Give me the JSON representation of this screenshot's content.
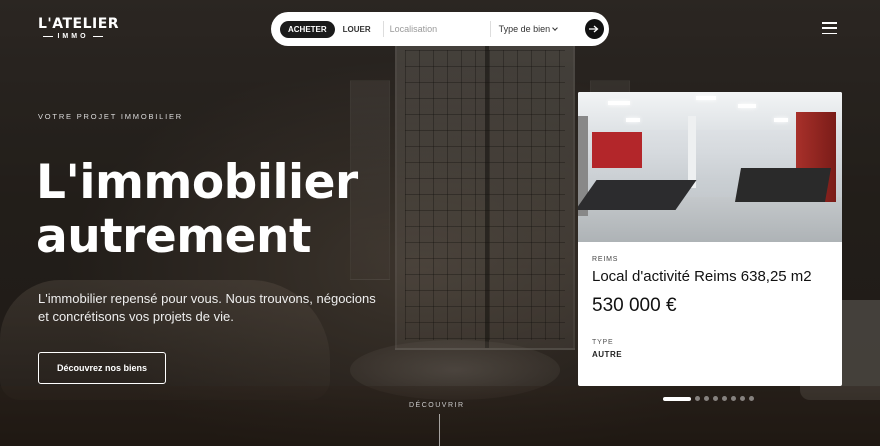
{
  "brand": {
    "logo_top": "L'ATELIER",
    "logo_bottom": "IMMO"
  },
  "search": {
    "buy_label": "ACHETER",
    "rent_label": "LOUER",
    "active_mode": "ACHETER",
    "location_placeholder": "Localisation",
    "type_label": "Type de bien",
    "submit_icon": "arrow-right-icon"
  },
  "menu": {
    "icon": "hamburger-menu-icon"
  },
  "hero": {
    "eyebrow": "VOTRE PROJET IMMOBILIER",
    "headline_line1": "L'immobilier",
    "headline_line2": "autrement",
    "subtitle": "L'immobilier repensé pour vous. Nous trouvons, négocions et concrétisons vos projets de vie.",
    "cta_label": "Découvrez nos biens",
    "scroll_label": "DÉCOUVRIR"
  },
  "featured_property": {
    "city": "REIMS",
    "title": "Local d'activité Reims 638,25 m2",
    "price": "530 000 €",
    "type_label": "TYPE",
    "type_value": "AUTRE"
  },
  "carousel": {
    "total_slides": 8,
    "active_index": 0
  },
  "colors": {
    "accent": "#111111",
    "card_background": "#ffffff",
    "text_light": "#ffffff"
  }
}
